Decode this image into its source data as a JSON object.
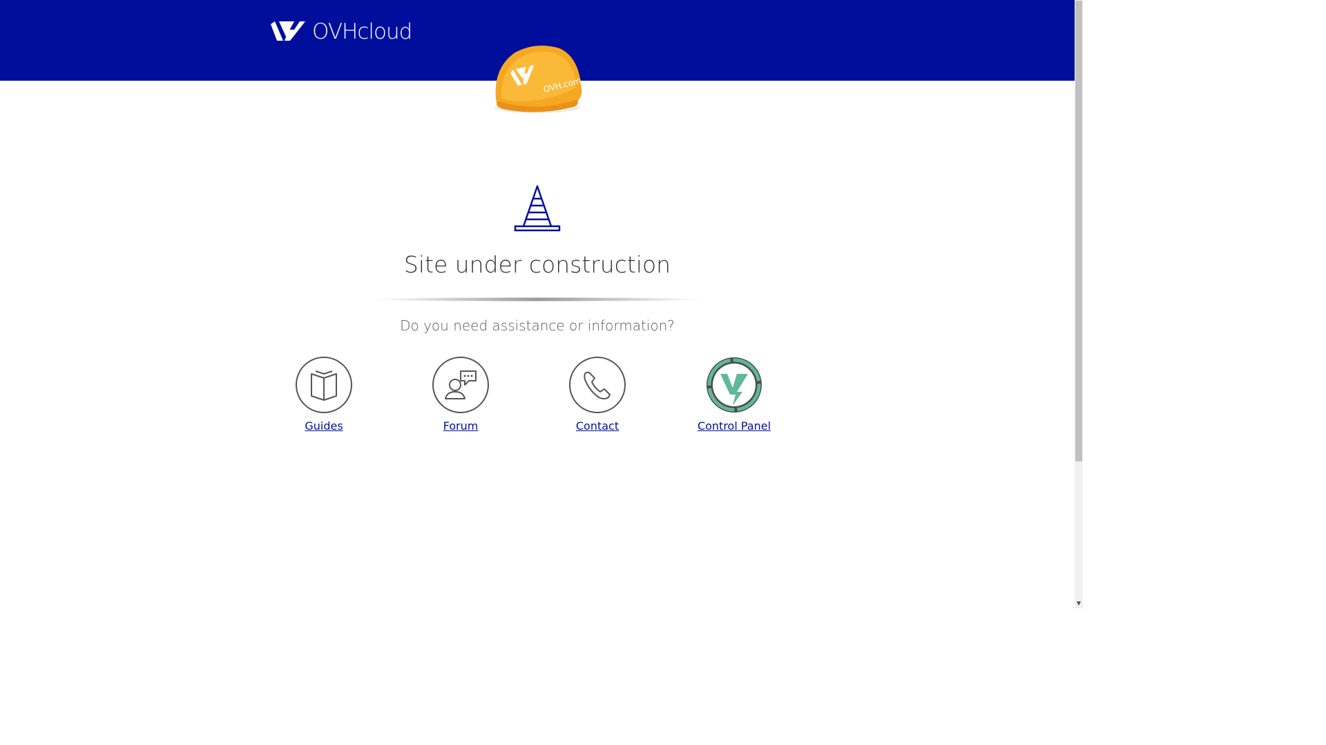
{
  "header": {
    "logo_text": "OVHcloud",
    "helmet_text": "OVH.com",
    "bg_color": "#000e9c"
  },
  "main": {
    "title": "Site under construction",
    "subtitle": "Do you need assistance or information?"
  },
  "links": [
    {
      "label": "Guides",
      "icon": "book-icon"
    },
    {
      "label": "Forum",
      "icon": "forum-icon"
    },
    {
      "label": "Contact",
      "icon": "phone-icon"
    },
    {
      "label": "Control Panel",
      "icon": "control-panel-icon"
    }
  ],
  "colors": {
    "accent": "#000e9c",
    "helmet": "#f7a823",
    "control_panel_green": "#5fb89a"
  }
}
